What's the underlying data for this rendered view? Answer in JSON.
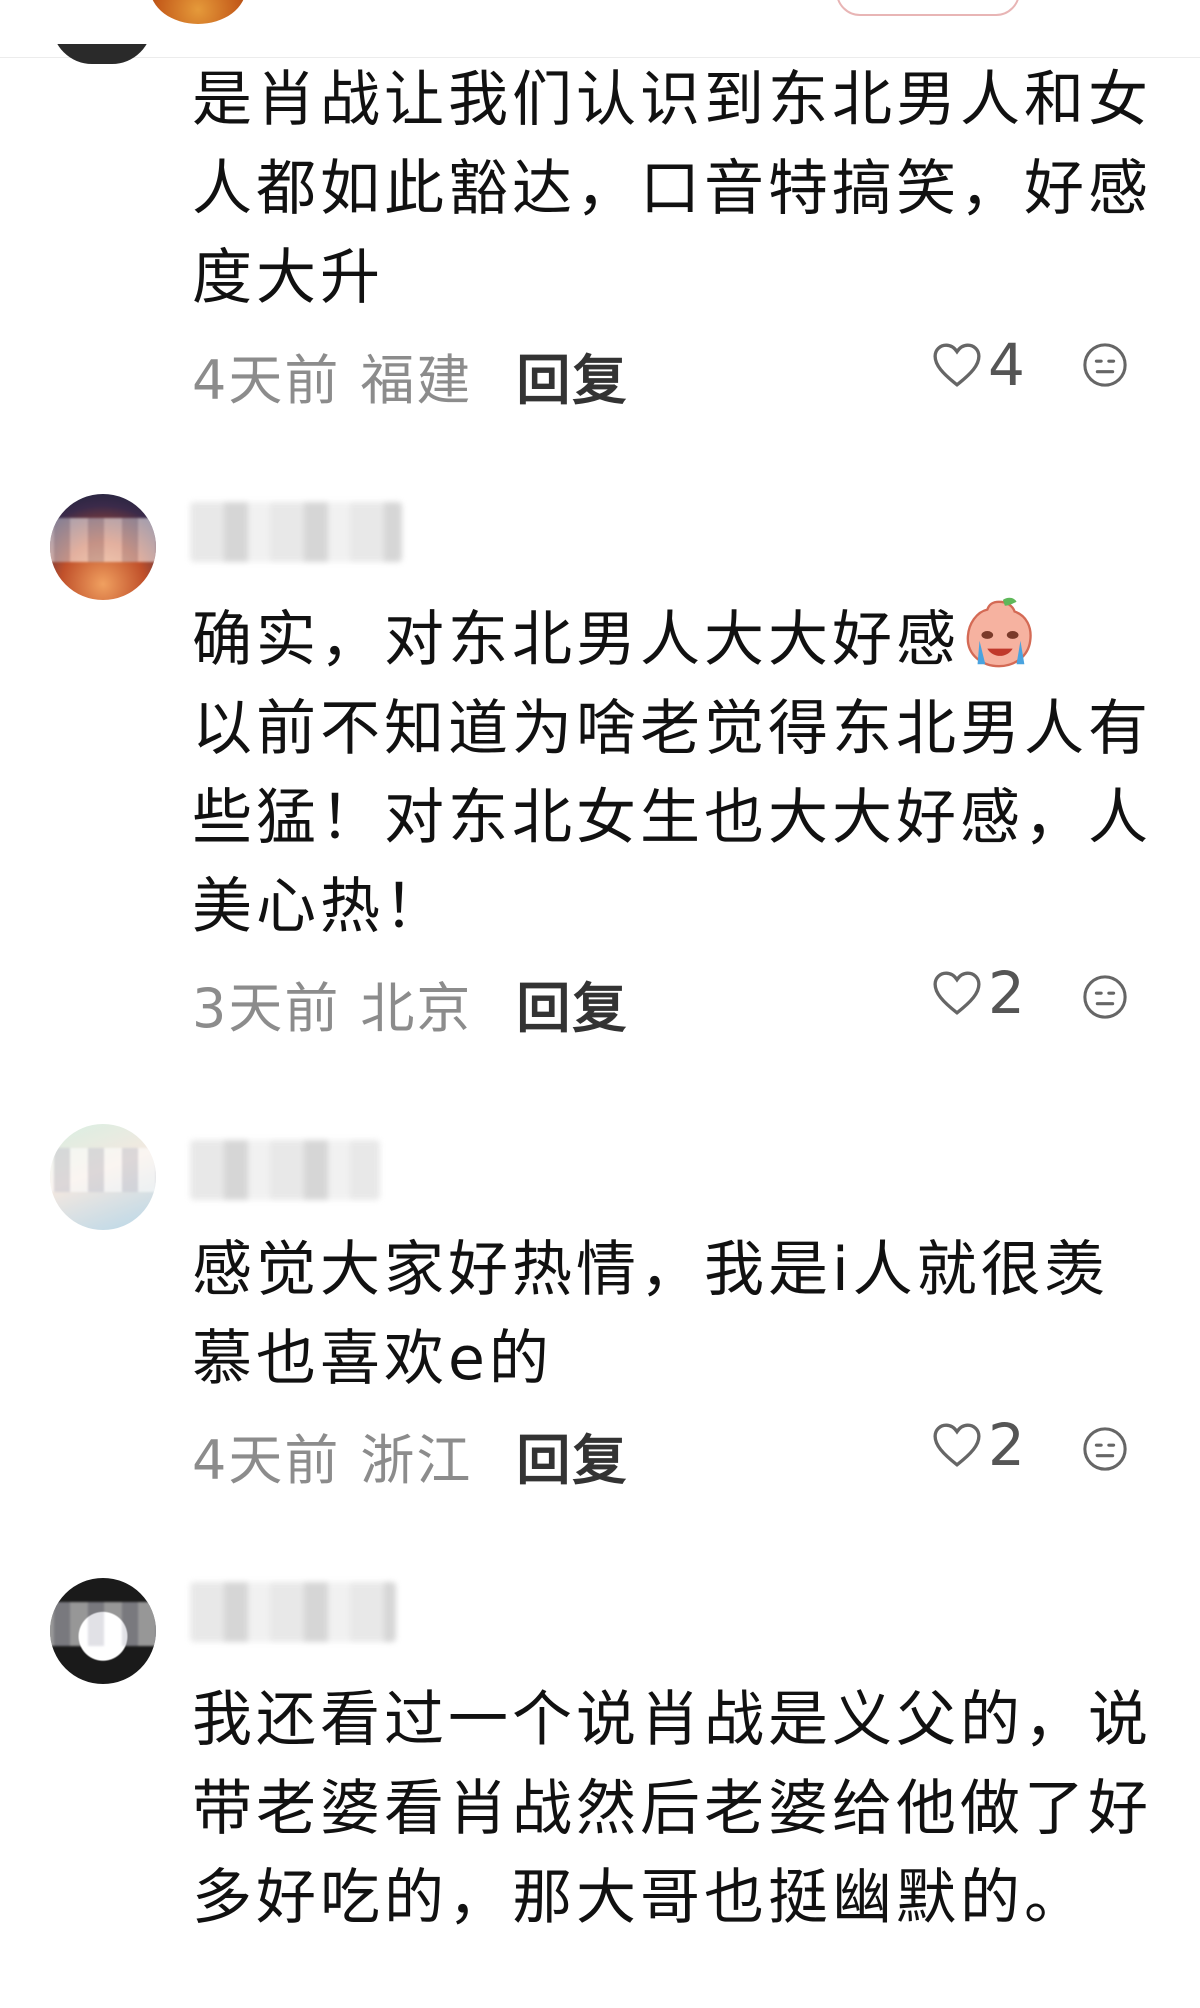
{
  "comments": [
    {
      "text": "是肖战让我们认识到东北男人和女人都如此豁达，口音特搞笑，好感度大升",
      "time": "4天前",
      "region": "福建",
      "reply_label": "回复",
      "likes": "4"
    },
    {
      "text_before_emoji": "确实，对东北男人大大好感",
      "text_after_emoji": "以前不知道为啥老觉得东北男人有些猛！对东北女生也大大好感，人美心热！",
      "inline_emoji": "crying-face-emoji",
      "time": "3天前",
      "region": "北京",
      "reply_label": "回复",
      "likes": "2"
    },
    {
      "text": "感觉大家好热情，我是i人就很羡慕也喜欢e的",
      "time": "4天前",
      "region": "浙江",
      "reply_label": "回复",
      "likes": "2"
    },
    {
      "text": "我还看过一个说肖战是义父的，说带老婆看肖战然后老婆给他做了好多好吃的，那大哥也挺幽默的。"
    }
  ],
  "icons": {
    "like": "heart-icon",
    "emoji_reaction": "smiley-icon"
  },
  "colors": {
    "meta_text": "#8c8c8c",
    "reply_text": "#333333",
    "body_text": "#111111"
  }
}
